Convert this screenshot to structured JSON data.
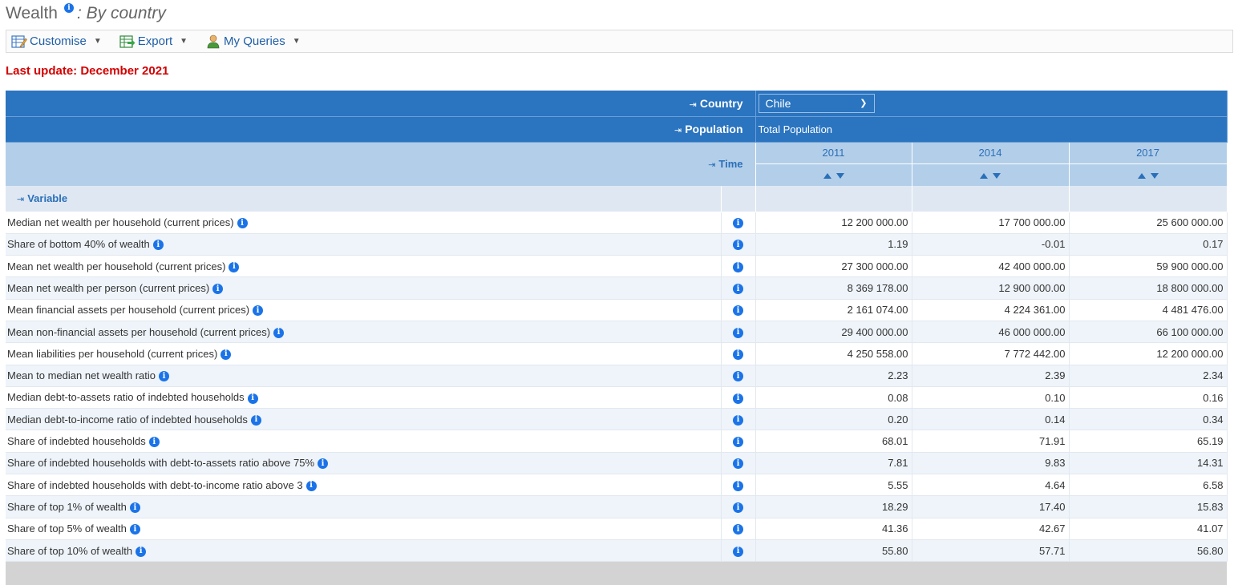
{
  "header": {
    "title": "Wealth",
    "subtitle": ": By country"
  },
  "toolbar": {
    "customise_label": "Customise",
    "export_label": "Export",
    "queries_label": "My Queries"
  },
  "last_update": "Last update: December 2021",
  "table": {
    "country_label": "Country",
    "country_value": "Chile",
    "population_label": "Population",
    "population_value": "Total Population",
    "time_label": "Time",
    "variable_label": "Variable",
    "years": [
      "2011",
      "2014",
      "2017"
    ],
    "rows": [
      {
        "name": "Median net wealth per household (current prices)",
        "values": [
          "12 200 000.00",
          "17 700 000.00",
          "25 600 000.00"
        ]
      },
      {
        "name": "Share of bottom 40% of wealth",
        "values": [
          "1.19",
          "-0.01",
          "0.17"
        ]
      },
      {
        "name": "Mean net wealth per household (current prices)",
        "values": [
          "27 300 000.00",
          "42 400 000.00",
          "59 900 000.00"
        ]
      },
      {
        "name": "Mean net wealth per person (current prices)",
        "values": [
          "8 369 178.00",
          "12 900 000.00",
          "18 800 000.00"
        ]
      },
      {
        "name": "Mean financial assets per household (current prices)",
        "values": [
          "2 161 074.00",
          "4 224 361.00",
          "4 481 476.00"
        ]
      },
      {
        "name": "Mean non-financial assets per household (current prices)",
        "values": [
          "29 400 000.00",
          "46 000 000.00",
          "66 100 000.00"
        ]
      },
      {
        "name": "Mean liabilities per household (current prices)",
        "values": [
          "4 250 558.00",
          "7 772 442.00",
          "12 200 000.00"
        ]
      },
      {
        "name": "Mean to median net wealth ratio",
        "values": [
          "2.23",
          "2.39",
          "2.34"
        ]
      },
      {
        "name": "Median debt-to-assets ratio of indebted households",
        "values": [
          "0.08",
          "0.10",
          "0.16"
        ]
      },
      {
        "name": "Median debt-to-income ratio of indebted households",
        "values": [
          "0.20",
          "0.14",
          "0.34"
        ]
      },
      {
        "name": "Share of indebted households",
        "values": [
          "68.01",
          "71.91",
          "65.19"
        ]
      },
      {
        "name": "Share of indebted households with debt-to-assets ratio above 75%",
        "values": [
          "7.81",
          "9.83",
          "14.31"
        ]
      },
      {
        "name": "Share of indebted households with debt-to-income ratio above 3",
        "values": [
          "5.55",
          "4.64",
          "6.58"
        ]
      },
      {
        "name": "Share of top 1% of wealth",
        "values": [
          "18.29",
          "17.40",
          "15.83"
        ]
      },
      {
        "name": "Share of top 5% of wealth",
        "values": [
          "41.36",
          "42.67",
          "41.07"
        ]
      },
      {
        "name": "Share of top 10% of wealth",
        "values": [
          "55.80",
          "57.71",
          "56.80"
        ]
      }
    ]
  },
  "colors": {
    "header_dark": "#2a74c0",
    "header_light": "#b3cee9",
    "accent_red": "#d40000",
    "link_blue": "#1f5fa8"
  }
}
